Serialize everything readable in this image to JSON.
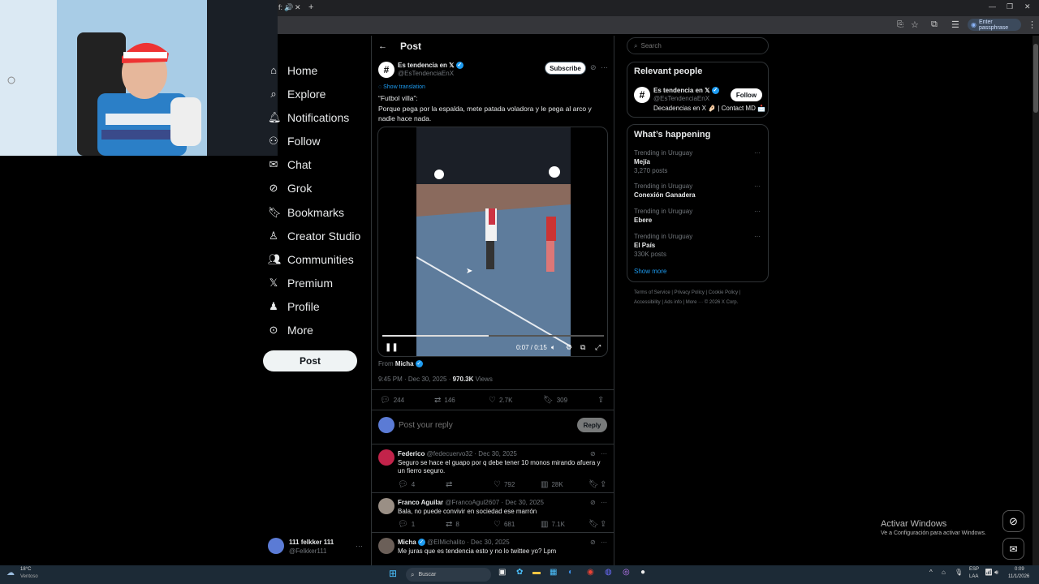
{
  "browser": {
    "tab_close": "✕",
    "new_tab": "+",
    "passphrase_label": "Enter passphrase",
    "window_controls": [
      "—",
      "❐",
      "✕"
    ]
  },
  "sidebar": {
    "items": [
      {
        "label": "Home",
        "icon": "home-icon"
      },
      {
        "label": "Explore",
        "icon": "search-icon"
      },
      {
        "label": "Notifications",
        "icon": "bell-icon"
      },
      {
        "label": "Follow",
        "icon": "person-plus-icon"
      },
      {
        "label": "Chat",
        "icon": "envelope-icon"
      },
      {
        "label": "Grok",
        "icon": "grok-icon"
      },
      {
        "label": "Bookmarks",
        "icon": "bookmark-icon"
      },
      {
        "label": "Creator Studio",
        "icon": "creator-icon"
      },
      {
        "label": "Communities",
        "icon": "people-icon"
      },
      {
        "label": "Premium",
        "icon": "x-logo-icon"
      },
      {
        "label": "Profile",
        "icon": "person-icon"
      },
      {
        "label": "More",
        "icon": "more-circle-icon"
      }
    ],
    "post_button": "Post",
    "account": {
      "name": "111 felkker 111",
      "handle": "@Felkker111",
      "more": "···"
    }
  },
  "main": {
    "header_title": "Post",
    "author": {
      "name": "Es tendencia en 𝕏",
      "handle": "@EsTendenciaEnX"
    },
    "subscribe_label": "Subscribe",
    "show_translation": "Show translation",
    "text_line1": "“Futbol villa”:",
    "text_line2": "Porque pega por la espalda, mete patada voladora y le pega al arco y nadie hace nada.",
    "video": {
      "time": "0:07 / 0:15",
      "progress": 0.48
    },
    "from_label": "From",
    "from_name": "Micha",
    "meta_date": "9:45 PM · Dec 30, 2025 · ",
    "meta_views": "970.3K",
    "meta_views_label": " Views",
    "actions": {
      "replies": "244",
      "reposts": "146",
      "likes": "2.7K",
      "bookmarks": "309"
    },
    "reply_placeholder": "Post your reply",
    "reply_button": "Reply",
    "replies": [
      {
        "name": "Federico",
        "handle": "@fedecuervo32 · Dec 30, 2025",
        "text": "Seguro se hace el guapo por q debe tener 10 monos mirando afuera y un fierro seguro.",
        "replies": "4",
        "reposts": "",
        "likes": "792",
        "views": "28K"
      },
      {
        "name": "Franco Aguilar",
        "handle": "@FrancoAgul2607 · Dec 30, 2025",
        "text": "Bala, no puede convivir en sociedad ese marrón",
        "replies": "1",
        "reposts": "8",
        "likes": "681",
        "views": "7.1K"
      },
      {
        "name": "Micha",
        "handle": "@ElMichalito · Dec 30, 2025",
        "text": "Me juras que es tendencia esto y no lo twittee yo? Lpm",
        "replies": "",
        "reposts": "",
        "likes": "",
        "views": ""
      }
    ]
  },
  "right": {
    "search_placeholder": "Search",
    "relevant_title": "Relevant people",
    "relevant_person": {
      "name": "Es tendencia en 𝕏",
      "handle": "@EsTendenciaEnX",
      "bio": "Decadencias en X 🤌🏻 | Contact MD 📩",
      "follow_label": "Follow"
    },
    "happening_title": "What’s happening",
    "trends": [
      {
        "context": "Trending in Uruguay",
        "name": "Mejía",
        "posts": "3,270 posts"
      },
      {
        "context": "Trending in Uruguay",
        "name": "Conexión Ganadera",
        "posts": ""
      },
      {
        "context": "Trending in Uruguay",
        "name": "Ebere",
        "posts": ""
      },
      {
        "context": "Trending in Uruguay",
        "name": "El País",
        "posts": "330K posts"
      }
    ],
    "show_more": "Show more",
    "footer_line1": "Terms of Service  |  Privacy Policy  |  Cookie Policy  |",
    "footer_line2": "Accessibility  |  Ads info  |  More ···  © 2026 X Corp."
  },
  "windows": {
    "activate_title": "Activar Windows",
    "activate_sub": "Ve a Configuración para activar Windows."
  },
  "taskbar": {
    "weather_temp": "18°C",
    "weather_desc": "Ventoso",
    "search": "Buscar",
    "lang1": "ESP",
    "lang2": "LAA",
    "time": "0:09",
    "date": "11/1/2026"
  },
  "colors": {
    "accent": "#1d9bf0",
    "background": "#000000",
    "border": "#2f3336"
  }
}
